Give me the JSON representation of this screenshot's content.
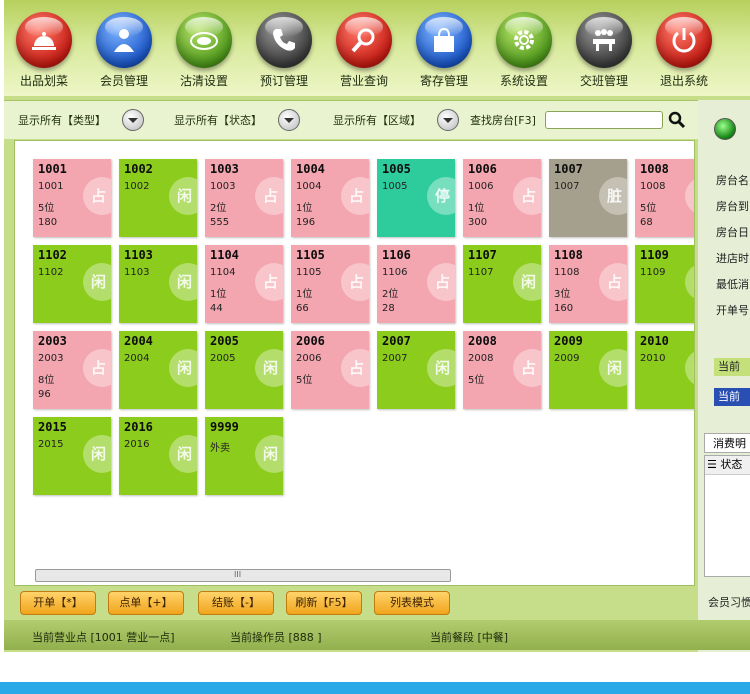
{
  "toolbar": [
    {
      "label": "出品划菜",
      "icon": "cloche-icon",
      "color": "red"
    },
    {
      "label": "会员管理",
      "icon": "member-icon",
      "color": "blue"
    },
    {
      "label": "沽清设置",
      "icon": "plate-icon",
      "color": "green"
    },
    {
      "label": "预订管理",
      "icon": "phone-icon",
      "color": "gray"
    },
    {
      "label": "营业查询",
      "icon": "magnifier-icon",
      "color": "red"
    },
    {
      "label": "寄存管理",
      "icon": "bag-icon",
      "color": "blue"
    },
    {
      "label": "系统设置",
      "icon": "gear-icon",
      "color": "green"
    },
    {
      "label": "交班管理",
      "icon": "meeting-icon",
      "color": "gray"
    },
    {
      "label": "退出系统",
      "icon": "power-icon",
      "color": "red"
    }
  ],
  "filters": {
    "type": "显示所有【类型】",
    "status": "显示所有【状态】",
    "area": "显示所有【区域】",
    "search_label": "查找房台[F3]",
    "search_value": ""
  },
  "status_badges": {
    "occupied": "占",
    "free": "闲",
    "stopped": "停",
    "dirty": "脏"
  },
  "tiles": [
    {
      "no": "1001",
      "lines": [
        "1001",
        "5位",
        "180"
      ],
      "state": "occupied"
    },
    {
      "no": "1002",
      "lines": [
        "1002"
      ],
      "state": "free"
    },
    {
      "no": "1003",
      "lines": [
        "1003",
        "2位",
        "555"
      ],
      "state": "occupied"
    },
    {
      "no": "1004",
      "lines": [
        "1004",
        "1位",
        "196"
      ],
      "state": "occupied"
    },
    {
      "no": "1005",
      "lines": [
        "1005"
      ],
      "state": "stopped"
    },
    {
      "no": "1006",
      "lines": [
        "1006",
        "1位",
        "300"
      ],
      "state": "occupied"
    },
    {
      "no": "1007",
      "lines": [
        "1007"
      ],
      "state": "dirty"
    },
    {
      "no": "1008",
      "lines": [
        "1008",
        "5位",
        "68"
      ],
      "state": "occupied"
    },
    {
      "no": "1102",
      "lines": [
        "1102"
      ],
      "state": "free"
    },
    {
      "no": "1103",
      "lines": [
        "1103"
      ],
      "state": "free"
    },
    {
      "no": "1104",
      "lines": [
        "1104",
        "1位",
        "44"
      ],
      "state": "occupied"
    },
    {
      "no": "1105",
      "lines": [
        "1105",
        "1位",
        "66"
      ],
      "state": "occupied"
    },
    {
      "no": "1106",
      "lines": [
        "1106",
        "2位",
        "28"
      ],
      "state": "occupied"
    },
    {
      "no": "1107",
      "lines": [
        "1107"
      ],
      "state": "free"
    },
    {
      "no": "1108",
      "lines": [
        "1108",
        "3位",
        "160"
      ],
      "state": "occupied"
    },
    {
      "no": "1109",
      "lines": [
        "1109"
      ],
      "state": "free"
    },
    {
      "no": "2003",
      "lines": [
        "2003",
        "8位",
        "96"
      ],
      "state": "occupied"
    },
    {
      "no": "2004",
      "lines": [
        "2004"
      ],
      "state": "free"
    },
    {
      "no": "2005",
      "lines": [
        "2005"
      ],
      "state": "free"
    },
    {
      "no": "2006",
      "lines": [
        "2006",
        "5位"
      ],
      "state": "occupied"
    },
    {
      "no": "2007",
      "lines": [
        "2007"
      ],
      "state": "free"
    },
    {
      "no": "2008",
      "lines": [
        "2008",
        "5位"
      ],
      "state": "occupied"
    },
    {
      "no": "2009",
      "lines": [
        "2009"
      ],
      "state": "free"
    },
    {
      "no": "2010",
      "lines": [
        "2010"
      ],
      "state": "free"
    },
    {
      "no": "2015",
      "lines": [
        "2015"
      ],
      "state": "free"
    },
    {
      "no": "2016",
      "lines": [
        "2016"
      ],
      "state": "free"
    },
    {
      "no": "9999",
      "lines": [
        "外卖"
      ],
      "state": "free"
    }
  ],
  "scrollbar_grip": "III",
  "right_panel": {
    "labels": [
      "房台名",
      "房台到",
      "房台日",
      "进店时",
      "最低消",
      "开单号"
    ],
    "box1": "当前",
    "box2": "当前",
    "tab": "消费明",
    "grid_header": "状态",
    "footer": "会员习惯"
  },
  "actions": [
    "开单【*】",
    "点单【+】",
    "结账【-】",
    "刷新【F5】",
    "列表模式"
  ],
  "statusbar": {
    "point": "当前营业点 [1001 营业一点]",
    "operator": "当前操作员 [888 ]",
    "meal": "当前餐段 [中餐]"
  },
  "colors": {
    "occupied": "#f4a6b0",
    "free": "#8ccc1c",
    "stopped": "#2ecc9c",
    "dirty": "#a5a08d"
  }
}
